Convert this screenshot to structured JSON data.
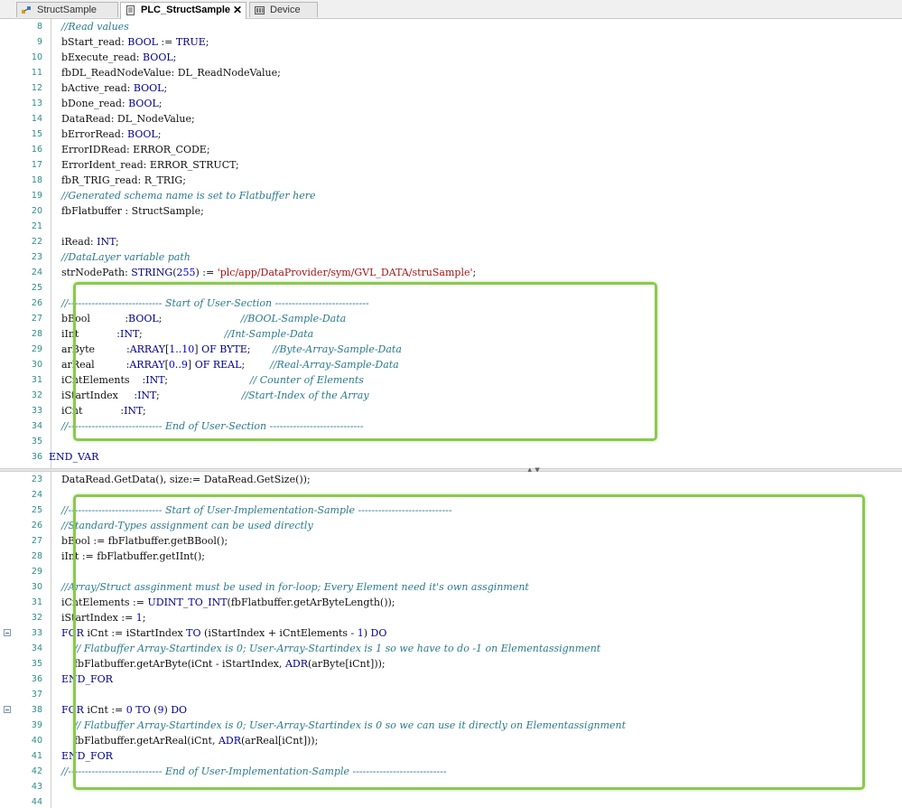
{
  "tabs": [
    {
      "label": "StructSample",
      "active": false,
      "icon": "struct-icon"
    },
    {
      "label": "PLC_StructSample",
      "active": true,
      "icon": "document-icon"
    },
    {
      "label": "Device",
      "active": false,
      "icon": "device-icon"
    }
  ],
  "tab_close_label": "✕",
  "declaration_editor": {
    "lines": [
      {
        "n": "8",
        "t": [
          {
            "c": "cm",
            "v": "        //Read values"
          }
        ]
      },
      {
        "n": "9",
        "t": [
          {
            "v": "        bStart_read: "
          },
          {
            "c": "kw",
            "v": "BOOL"
          },
          {
            "v": " := "
          },
          {
            "c": "kw",
            "v": "TRUE"
          },
          {
            "v": ";"
          }
        ]
      },
      {
        "n": "10",
        "t": [
          {
            "v": "        bExecute_read: "
          },
          {
            "c": "kw",
            "v": "BOOL"
          },
          {
            "v": ";"
          }
        ]
      },
      {
        "n": "11",
        "t": [
          {
            "v": "        fbDL_ReadNodeValue: DL_ReadNodeValue;"
          }
        ]
      },
      {
        "n": "12",
        "t": [
          {
            "v": "        bActive_read: "
          },
          {
            "c": "kw",
            "v": "BOOL"
          },
          {
            "v": ";"
          }
        ]
      },
      {
        "n": "13",
        "t": [
          {
            "v": "        bDone_read: "
          },
          {
            "c": "kw",
            "v": "BOOL"
          },
          {
            "v": ";"
          }
        ]
      },
      {
        "n": "14",
        "t": [
          {
            "v": "        DataRead: DL_NodeValue;"
          }
        ]
      },
      {
        "n": "15",
        "t": [
          {
            "v": "        bErrorRead: "
          },
          {
            "c": "kw",
            "v": "BOOL"
          },
          {
            "v": ";"
          }
        ]
      },
      {
        "n": "16",
        "t": [
          {
            "v": "        ErrorIDRead: ERROR_CODE;"
          }
        ]
      },
      {
        "n": "17",
        "t": [
          {
            "v": "        ErrorIdent_read: ERROR_STRUCT;"
          }
        ]
      },
      {
        "n": "18",
        "t": [
          {
            "v": "        fbR_TRIG_read: R_TRIG;"
          }
        ]
      },
      {
        "n": "19",
        "t": [
          {
            "c": "cm",
            "v": "        //Generated schema name is set to Flatbuffer here"
          }
        ]
      },
      {
        "n": "20",
        "t": [
          {
            "v": "        fbFlatbuffer : StructSample;"
          }
        ]
      },
      {
        "n": "21",
        "t": [
          {
            "v": ""
          }
        ]
      },
      {
        "n": "22",
        "t": [
          {
            "v": "        iRead: "
          },
          {
            "c": "kw",
            "v": "INT"
          },
          {
            "v": ";"
          }
        ]
      },
      {
        "n": "23",
        "t": [
          {
            "c": "cm",
            "v": "        //DataLayer variable path"
          }
        ]
      },
      {
        "n": "24",
        "t": [
          {
            "v": "        strNodePath: "
          },
          {
            "c": "kw",
            "v": "STRING"
          },
          {
            "v": "("
          },
          {
            "c": "num",
            "v": "255"
          },
          {
            "v": ") := "
          },
          {
            "c": "str",
            "v": "'plc/app/DataProvider/sym/GVL_DATA/struSample'"
          },
          {
            "v": ";"
          }
        ]
      },
      {
        "n": "25",
        "t": [
          {
            "v": ""
          }
        ]
      },
      {
        "n": "26",
        "t": [
          {
            "c": "cm",
            "v": "        //---------------------------- Start of User-Section ----------------------------"
          }
        ]
      },
      {
        "n": "27",
        "t": [
          {
            "v": "        bBool           :"
          },
          {
            "c": "kw",
            "v": "BOOL"
          },
          {
            "v": ";                         "
          },
          {
            "c": "cm",
            "v": "//BOOL-Sample-Data"
          }
        ]
      },
      {
        "n": "28",
        "t": [
          {
            "v": "        iInt            :"
          },
          {
            "c": "kw",
            "v": "INT"
          },
          {
            "v": ";                          "
          },
          {
            "c": "cm",
            "v": "//Int-Sample-Data"
          }
        ]
      },
      {
        "n": "29",
        "t": [
          {
            "v": "        arByte          :"
          },
          {
            "c": "kw",
            "v": "ARRAY"
          },
          {
            "v": "["
          },
          {
            "c": "num",
            "v": "1"
          },
          {
            "v": ".."
          },
          {
            "c": "num",
            "v": "10"
          },
          {
            "v": "] "
          },
          {
            "c": "kw",
            "v": "OF BYTE"
          },
          {
            "v": ";       "
          },
          {
            "c": "cm",
            "v": "//Byte-Array-Sample-Data"
          }
        ]
      },
      {
        "n": "30",
        "t": [
          {
            "v": "        arReal          :"
          },
          {
            "c": "kw",
            "v": "ARRAY"
          },
          {
            "v": "["
          },
          {
            "c": "num",
            "v": "0"
          },
          {
            "v": ".."
          },
          {
            "c": "num",
            "v": "9"
          },
          {
            "v": "] "
          },
          {
            "c": "kw",
            "v": "OF REAL"
          },
          {
            "v": ";        "
          },
          {
            "c": "cm",
            "v": "//Real-Array-Sample-Data"
          }
        ]
      },
      {
        "n": "31",
        "t": [
          {
            "v": "        iCntElements    :"
          },
          {
            "c": "kw",
            "v": "INT"
          },
          {
            "v": ";                          "
          },
          {
            "c": "cm",
            "v": "// Counter of Elements"
          }
        ]
      },
      {
        "n": "32",
        "t": [
          {
            "v": "        iStartIndex     :"
          },
          {
            "c": "kw",
            "v": "INT"
          },
          {
            "v": ";                          "
          },
          {
            "c": "cm",
            "v": "//Start-Index of the Array"
          }
        ]
      },
      {
        "n": "33",
        "t": [
          {
            "v": "        iCnt            :"
          },
          {
            "c": "kw",
            "v": "INT"
          },
          {
            "v": ";"
          }
        ]
      },
      {
        "n": "34",
        "t": [
          {
            "c": "cm",
            "v": "        //---------------------------- End of User-Section ----------------------------"
          }
        ]
      },
      {
        "n": "35",
        "t": [
          {
            "v": ""
          }
        ]
      },
      {
        "n": "36",
        "t": [
          {
            "v": "    "
          },
          {
            "c": "kw",
            "v": "END_VAR"
          }
        ]
      }
    ]
  },
  "implementation_editor": {
    "lines": [
      {
        "n": "23",
        "t": [
          {
            "v": "        DataRead.GetData(), size:= DataRead.GetSize());"
          }
        ]
      },
      {
        "n": "24",
        "t": [
          {
            "v": ""
          }
        ]
      },
      {
        "n": "25",
        "t": [
          {
            "c": "cm",
            "v": "        //---------------------------- Start of User-Implementation-Sample ----------------------------"
          }
        ]
      },
      {
        "n": "26",
        "t": [
          {
            "c": "cm",
            "v": "        //Standard-Types assignment can be used directly"
          }
        ]
      },
      {
        "n": "27",
        "t": [
          {
            "v": "        bBool := fbFlatbuffer.getBBool();"
          }
        ]
      },
      {
        "n": "28",
        "t": [
          {
            "v": "        iInt := fbFlatbuffer.getIInt();"
          }
        ]
      },
      {
        "n": "29",
        "t": [
          {
            "v": ""
          }
        ]
      },
      {
        "n": "30",
        "t": [
          {
            "c": "cm",
            "v": "        //Array/Struct assginment must be used in for-loop; Every Element need it's own assginment"
          }
        ]
      },
      {
        "n": "31",
        "t": [
          {
            "v": "        iCntElements := "
          },
          {
            "c": "kw",
            "v": "UDINT_TO_INT"
          },
          {
            "v": "(fbFlatbuffer.getArByteLength());"
          }
        ]
      },
      {
        "n": "32",
        "t": [
          {
            "v": "        iStartIndex := "
          },
          {
            "c": "num",
            "v": "1"
          },
          {
            "v": ";"
          }
        ]
      },
      {
        "n": "33",
        "fold": true,
        "t": [
          {
            "v": "        "
          },
          {
            "c": "kw",
            "v": "FOR"
          },
          {
            "v": " iCnt := iStartIndex "
          },
          {
            "c": "kw",
            "v": "TO"
          },
          {
            "v": " (iStartIndex + iCntElements - "
          },
          {
            "c": "num",
            "v": "1"
          },
          {
            "v": ") "
          },
          {
            "c": "kw",
            "v": "DO"
          }
        ]
      },
      {
        "n": "34",
        "t": [
          {
            "c": "cm",
            "v": "            // Flatbuffer Array-Startindex is 0; User-Array-Startindex is 1 so we have to do -1 on Elementassignment"
          }
        ]
      },
      {
        "n": "35",
        "t": [
          {
            "v": "            fbFlatbuffer.getArByte(iCnt - iStartIndex, "
          },
          {
            "c": "kw",
            "v": "ADR"
          },
          {
            "v": "(arByte[iCnt]));"
          }
        ]
      },
      {
        "n": "36",
        "t": [
          {
            "v": "        "
          },
          {
            "c": "kw",
            "v": "END_FOR"
          }
        ]
      },
      {
        "n": "37",
        "t": [
          {
            "v": ""
          }
        ]
      },
      {
        "n": "38",
        "fold": true,
        "t": [
          {
            "v": "        "
          },
          {
            "c": "kw",
            "v": "FOR"
          },
          {
            "v": " iCnt := "
          },
          {
            "c": "num",
            "v": "0"
          },
          {
            "v": " "
          },
          {
            "c": "kw",
            "v": "TO"
          },
          {
            "v": " ("
          },
          {
            "c": "num",
            "v": "9"
          },
          {
            "v": ") "
          },
          {
            "c": "kw",
            "v": "DO"
          }
        ]
      },
      {
        "n": "39",
        "t": [
          {
            "c": "cm",
            "v": "            // Flatbuffer Array-Startindex is 0; User-Array-Startindex is 0 so we can use it directly on Elementassignment"
          }
        ]
      },
      {
        "n": "40",
        "t": [
          {
            "v": "            fbFlatbuffer.getArReal(iCnt, "
          },
          {
            "c": "kw",
            "v": "ADR"
          },
          {
            "v": "(arReal[iCnt]));"
          }
        ]
      },
      {
        "n": "41",
        "t": [
          {
            "v": "        "
          },
          {
            "c": "kw",
            "v": "END_FOR"
          }
        ]
      },
      {
        "n": "42",
        "t": [
          {
            "c": "cm",
            "v": "        //---------------------------- End of User-Implementation-Sample ----------------------------"
          }
        ]
      },
      {
        "n": "43",
        "t": [
          {
            "v": ""
          }
        ]
      },
      {
        "n": "44",
        "t": [
          {
            "v": ""
          }
        ]
      }
    ]
  },
  "splitter_arrows": "▲▼",
  "colors": {
    "highlight_border": "#8cc850",
    "keyword": "#00008b",
    "comment": "#2b7a8c",
    "string": "#a31515",
    "line_number": "#2e8b8b"
  }
}
